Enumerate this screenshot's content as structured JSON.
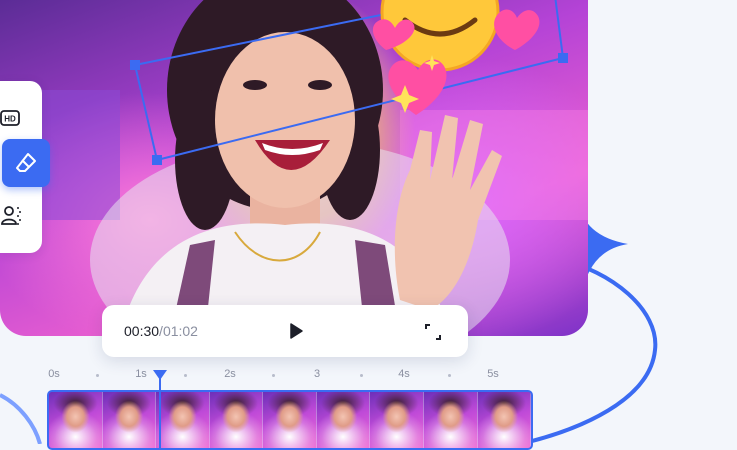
{
  "player": {
    "current_time": "00:30",
    "separator": "/",
    "duration": "01:02"
  },
  "timeline": {
    "ticks": [
      "0s",
      "1s",
      "2s",
      "3",
      "4s",
      "5s"
    ],
    "frame_count": 9
  },
  "toolbar": {
    "hd_label": "HD"
  },
  "colors": {
    "accent": "#3b6bf2",
    "background": "#f3f6fb",
    "panel": "#ffffff"
  },
  "icons": {
    "hd": "hd-quality-icon",
    "eraser": "eraser-icon",
    "person": "person-background-icon",
    "play": "play-icon",
    "fullscreen": "fullscreen-icon",
    "sparkle": "sparkle-star-icon"
  }
}
